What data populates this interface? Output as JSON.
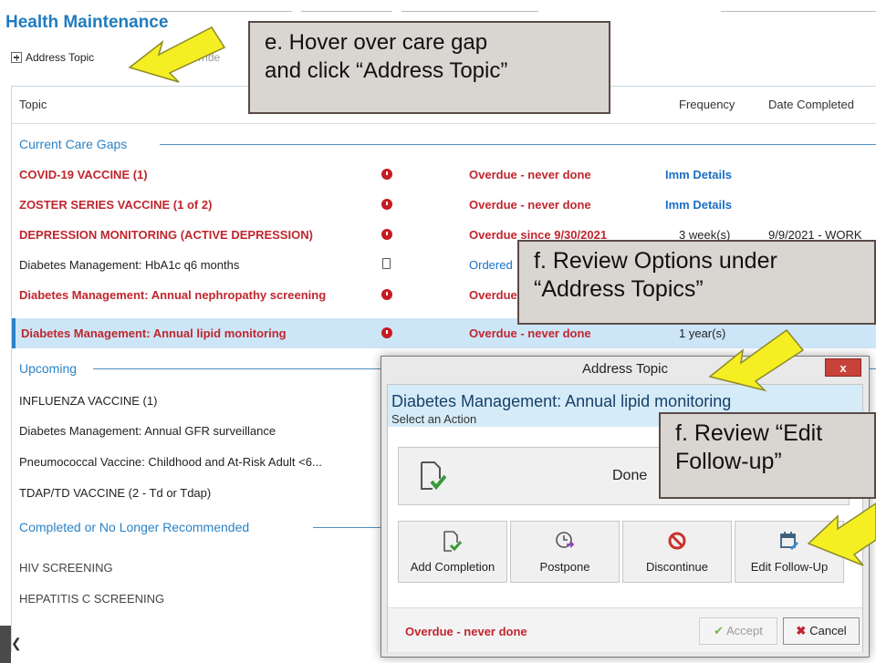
{
  "app": {
    "title": "Health Maintenance"
  },
  "toolbar": {
    "address_topic": "Address Topic",
    "override": "Override",
    "hidden_tail": "s"
  },
  "table": {
    "headers": {
      "topic": "Topic",
      "frequency": "Frequency",
      "date_completed": "Date Completed"
    },
    "sections": {
      "current": "Current Care Gaps",
      "upcoming": "Upcoming",
      "completed": "Completed or No Longer Recommended"
    },
    "current_rows": [
      {
        "topic": "COVID-19 VACCINE (1)",
        "status": "Overdue - never done",
        "frequency": "Imm Details",
        "date": ""
      },
      {
        "topic": "ZOSTER SERIES VACCINE (1 of 2)",
        "status": "Overdue - never done",
        "frequency": "Imm Details",
        "date": ""
      },
      {
        "topic": "DEPRESSION MONITORING (ACTIVE DEPRESSION)",
        "status": "Overdue since 9/30/2021",
        "frequency": "3 week(s)",
        "date": "9/9/2021 - WORK"
      },
      {
        "topic": "Diabetes Management: HbA1c q6 months",
        "status": "Ordered",
        "frequency": "",
        "date": ""
      },
      {
        "topic": "Diabetes Management: Annual nephropathy screening",
        "status": "Overdue",
        "frequency": "",
        "date": ""
      },
      {
        "topic": "Diabetes Management: Annual lipid monitoring",
        "status": "Overdue - never done",
        "frequency": "1 year(s)",
        "date": ""
      }
    ],
    "upcoming_rows": [
      {
        "topic": "INFLUENZA VACCINE (1)"
      },
      {
        "topic": "Diabetes Management: Annual GFR surveillance"
      },
      {
        "topic": "Pneumococcal Vaccine: Childhood and At-Risk Adult <6..."
      },
      {
        "topic": "TDAP/TD VACCINE (2 - Td or Tdap)"
      }
    ],
    "completed_rows": [
      {
        "topic": "HIV SCREENING"
      },
      {
        "topic": "HEPATITIS C SCREENING"
      }
    ]
  },
  "callouts": {
    "e": "e. Hover over care gap and click “Address Topic”",
    "e_line1": "e. Hover over care gap",
    "e_line2": "and click “Address Topic”",
    "f1_line1": "f. Review Options under",
    "f1_line2": "“Address Topics”",
    "f2_line1": "f. Review “Edit",
    "f2_line2": "Follow-up”"
  },
  "dialog": {
    "title": "Address Topic",
    "close": "x",
    "topic": "Diabetes Management: Annual lipid monitoring",
    "subtitle": "Select an Action",
    "done_label": "Done",
    "actions": [
      "Add Completion",
      "Postpone",
      "Discontinue",
      "Edit Follow-Up"
    ],
    "status": "Overdue - never done",
    "accept": "Accept",
    "cancel": "Cancel"
  },
  "colors": {
    "accent": "#1f7cc0",
    "overdue": "#c0262e",
    "selected_row": "#cde6f7",
    "callout_bg": "#d9d6d2",
    "arrow": "#f5ee22"
  }
}
